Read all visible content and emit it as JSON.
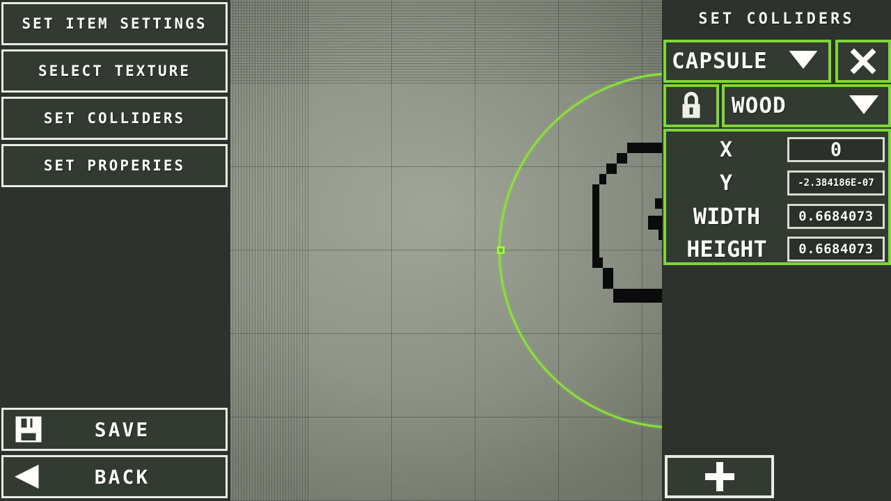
{
  "left_menu": {
    "items": [
      {
        "label": "SET ITEM SETTINGS",
        "name": "set-item-settings"
      },
      {
        "label": "SELECT TEXTURE",
        "name": "select-texture"
      },
      {
        "label": "SET COLLIDERS",
        "name": "set-colliders"
      },
      {
        "label": "SET PROPERIES",
        "name": "set-properies"
      }
    ],
    "save_label": "SAVE",
    "save_icon": "floppy-disk-icon",
    "back_label": "BACK",
    "back_icon": "left-triangle-icon"
  },
  "right_panel": {
    "title": "SET COLLIDERS",
    "shape": {
      "selected": "CAPSULE",
      "caret_icon": "chevron-down-icon",
      "close_icon": "close-x-icon"
    },
    "material": {
      "lock_icon": "lock-closed-icon",
      "selected": "WOOD",
      "caret_icon": "chevron-down-icon"
    },
    "fields": [
      {
        "label": "X",
        "value": "0"
      },
      {
        "label": "Y",
        "value": "-2.384186E-07"
      },
      {
        "label": "WIDTH",
        "value": "0.6684073"
      },
      {
        "label": "HEIGHT",
        "value": "0.6684073"
      }
    ],
    "add_button": {
      "label": "+",
      "icon": "plus-icon"
    }
  },
  "canvas": {
    "collider_shape": "circle",
    "handles": [
      "top",
      "bottom",
      "left",
      "right"
    ],
    "sprite": "smiley-face-sprite"
  },
  "colors": {
    "accent_green": "#7fd63a",
    "collider_outline": "#8bdf3c",
    "panel_bg": "#2d332c",
    "button_bg": "#333a31",
    "button_border": "#e9ece4",
    "text": "#fbfcf7",
    "canvas_bg": "#8e9487"
  }
}
